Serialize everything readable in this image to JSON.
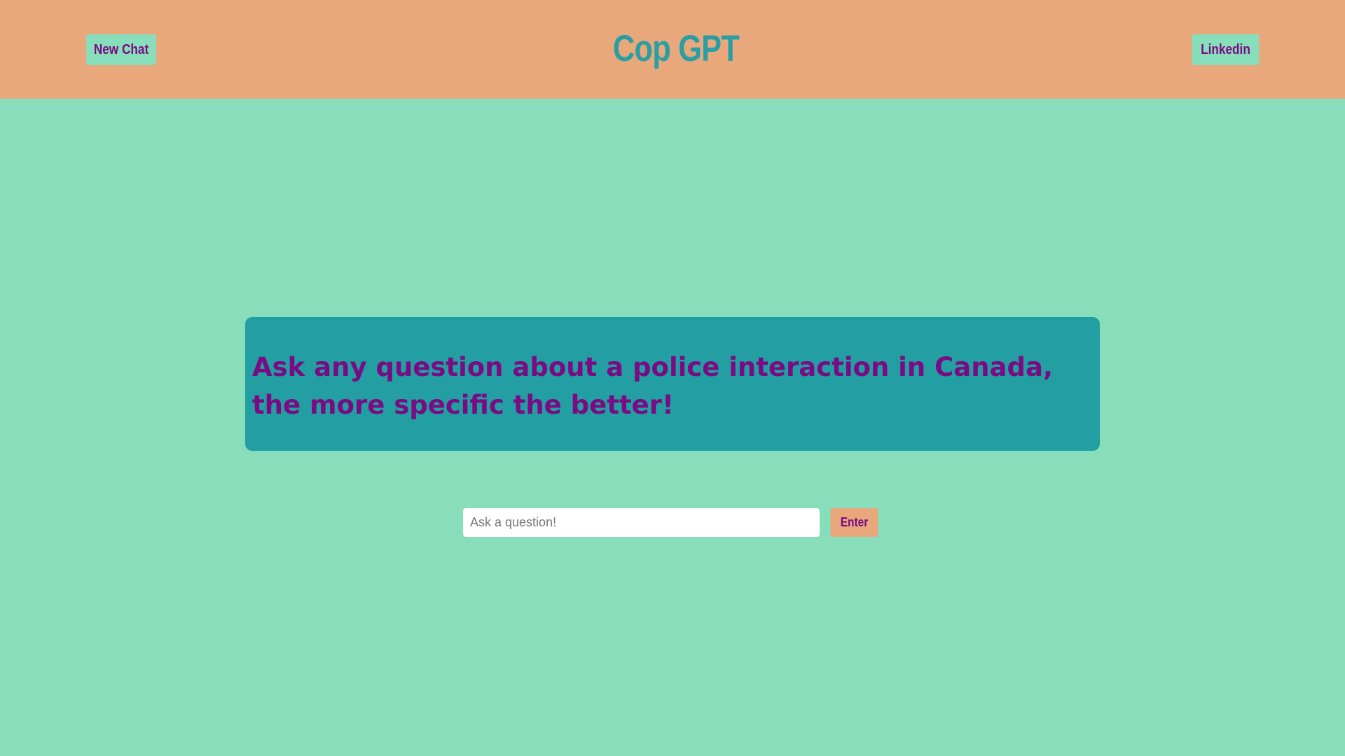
{
  "colors": {
    "header_background": "#E8A87C",
    "page_background": "#88DDBB",
    "card_background": "#239EA3",
    "title_color": "#2A9FA3",
    "text_color": "#7B0B83",
    "input_background": "#FFFFFF"
  },
  "header": {
    "title": "Cop GPT",
    "new_chat_label": "New Chat",
    "linkedin_label": "Linkedin"
  },
  "main": {
    "prompt": "Ask any question about a police interaction in Canada, the more specific the better!",
    "input": {
      "value": "",
      "placeholder": "Ask a question!"
    },
    "enter_label": "Enter"
  }
}
